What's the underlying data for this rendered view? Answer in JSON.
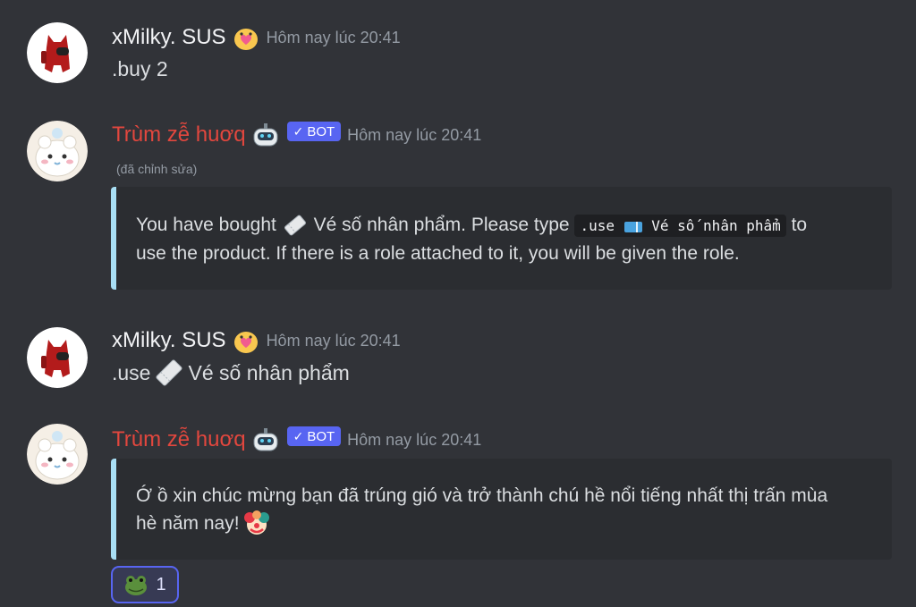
{
  "messages": [
    {
      "author": "xMilky. SUS",
      "timestamp": "Hôm nay lúc 20:41",
      "text": ".buy 2"
    },
    {
      "author": "Trùm zễ huơq",
      "bot_label": "BOT",
      "timestamp": "Hôm nay lúc 20:41",
      "edited": "(đã chỉnh sửa)",
      "embed": {
        "text_before": "You have bought",
        "product_name": "Vé số nhân phẩm. Please type",
        "command": ".use",
        "command_product": "Vé số nhân phẩm",
        "text_after": "to",
        "line2": "use the product. If there is a role attached to it, you will be given the role."
      }
    },
    {
      "author": "xMilky. SUS",
      "timestamp": "Hôm nay lúc 20:41",
      "text_prefix": ".use",
      "text_product": "Vé số nhân phẩm"
    },
    {
      "author": "Trùm zễ huơq",
      "bot_label": "BOT",
      "timestamp": "Hôm nay lúc 20:41",
      "embed": {
        "line1": "Ớ ồ xin chúc mừng bạn đã trúng gió và trở thành chú hề nổi tiếng nhất thị trấn mùa",
        "line2": "hè năm nay!"
      },
      "reaction": {
        "emoji": "frog-emoji",
        "count": "1"
      }
    }
  ],
  "colors": {
    "background": "#313338",
    "embed_bg": "#2b2d31",
    "embed_border": "#a8def4",
    "bot_name": "#e2473e",
    "bot_tag": "#5865f2"
  }
}
